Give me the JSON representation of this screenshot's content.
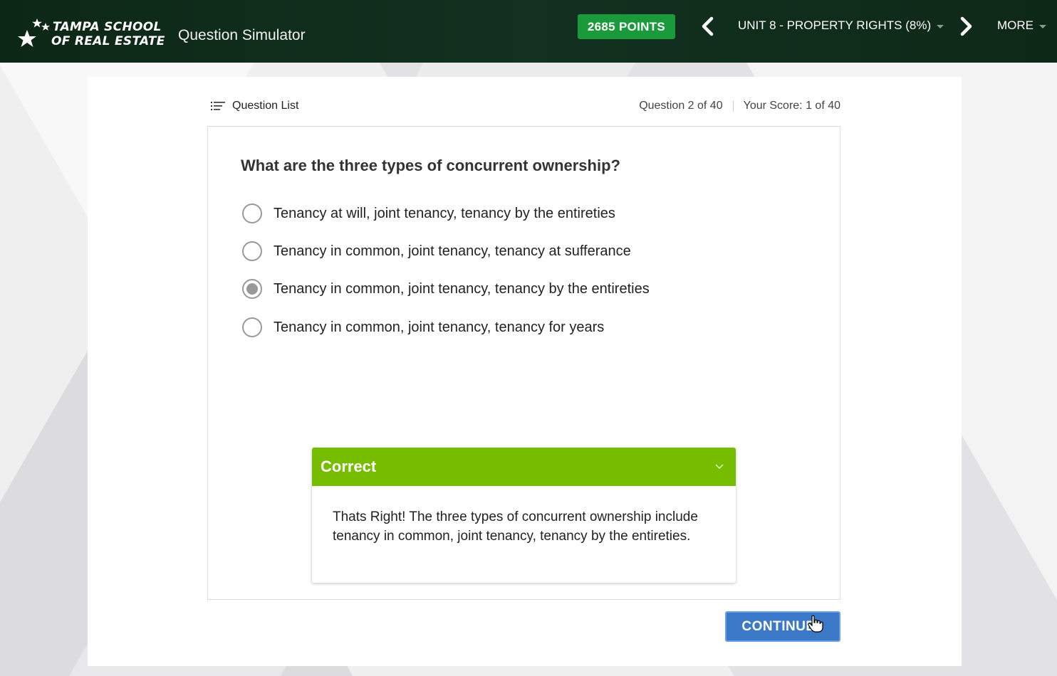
{
  "header": {
    "logo_line1": "TAMPA SCHOOL",
    "logo_line2": "OF REAL ESTATE",
    "app_title": "Question Simulator",
    "points": "2685 POINTS",
    "unit": "UNIT 8 - PROPERTY RIGHTS (8%)",
    "more": "MORE"
  },
  "toolbar": {
    "question_list": "Question List",
    "progress": "Question 2 of 40",
    "score": "Your Score: 1 of 40"
  },
  "question": {
    "text": "What are the three types of concurrent ownership?",
    "options": [
      {
        "label": "Tenancy at will, joint tenancy, tenancy by the entireties",
        "selected": false
      },
      {
        "label": "Tenancy in common, joint tenancy, tenancy at sufferance",
        "selected": false
      },
      {
        "label": "Tenancy in common, joint tenancy, tenancy by the entireties",
        "selected": true
      },
      {
        "label": "Tenancy in common, joint tenancy, tenancy for years",
        "selected": false
      }
    ]
  },
  "feedback": {
    "title": "Correct",
    "body": "Thats Right! The three types of concurrent ownership include tenancy in common, joint tenancy, tenancy by the entireties."
  },
  "actions": {
    "continue": "CONTINUE"
  },
  "colors": {
    "header_bg": "#0f2a18",
    "points_bg": "#1a9a3a",
    "correct_bg": "#76bd00",
    "continue_bg": "#3b78c8"
  },
  "icons": [
    "star-icon",
    "chevron-left-icon",
    "chevron-right-icon",
    "caret-down-icon",
    "list-icon",
    "radio-icon",
    "chevron-down-icon",
    "cursor-icon"
  ]
}
